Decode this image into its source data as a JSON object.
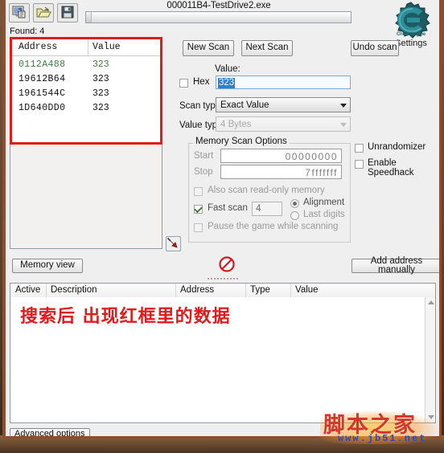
{
  "window": {
    "title": "000011B4-TestDrive2.exe",
    "found_label": "Found: 4",
    "logo_word": "Cheat Engine",
    "settings_label": "Settings"
  },
  "toolbar": {
    "process_title": "Open Process",
    "open_title": "Open file",
    "save_title": "Save file"
  },
  "scan_buttons": {
    "new_scan": "New Scan",
    "next_scan": "Next Scan",
    "undo_scan": "Undo scan"
  },
  "results": {
    "columns": [
      "Address",
      "Value"
    ],
    "rows": [
      {
        "address": "0112A488",
        "value": "323"
      },
      {
        "address": "19612B64",
        "value": "323"
      },
      {
        "address": "1961544C",
        "value": "323"
      },
      {
        "address": "1D640DD0",
        "value": "323"
      }
    ],
    "highlight_color": "#e21b1b",
    "first_row_color": "#3f7a3f"
  },
  "scan_panel": {
    "value_label": "Value:",
    "hex_label": "Hex",
    "hex_checked": false,
    "value_input": "323",
    "scan_type_label": "Scan type",
    "scan_type_value": "Exact Value",
    "value_type_label": "Value type",
    "value_type_value": "4 Bytes"
  },
  "memory_scan_options": {
    "title": "Memory Scan Options",
    "start_label": "Start",
    "start_value": "00000000",
    "stop_label": "Stop",
    "stop_value": "7fffffff",
    "readonly_label": "Also scan read-only memory",
    "readonly_checked": false,
    "fast_scan_label": "Fast scan",
    "fast_scan_checked": true,
    "fast_scan_value": "4",
    "alignment_label": "Alignment",
    "alignment_selected": true,
    "last_digits_label": "Last digits",
    "last_digits_selected": false,
    "pause_label": "Pause the game while scanning",
    "pause_checked": false
  },
  "side_options": {
    "unrandomizer_label": "Unrandomizer",
    "unrandomizer_checked": false,
    "speedhack_label": "Enable Speedhack",
    "speedhack_checked": false
  },
  "middle_bar": {
    "memory_view": "Memory view",
    "add_address": "Add address manually",
    "pointer_icon": "red-arrow-icon",
    "stop_icon": "no-entry-icon"
  },
  "cheat_table": {
    "columns": [
      "Active",
      "Description",
      "Address",
      "Type",
      "Value"
    ],
    "annotation": "搜索后 出现红框里的数据",
    "annotation_color": "#e01b1b",
    "rows": []
  },
  "status": {
    "advanced_options": "Advanced options"
  },
  "watermark": {
    "brand": "脚本之家",
    "url": "www.jb51.net"
  }
}
